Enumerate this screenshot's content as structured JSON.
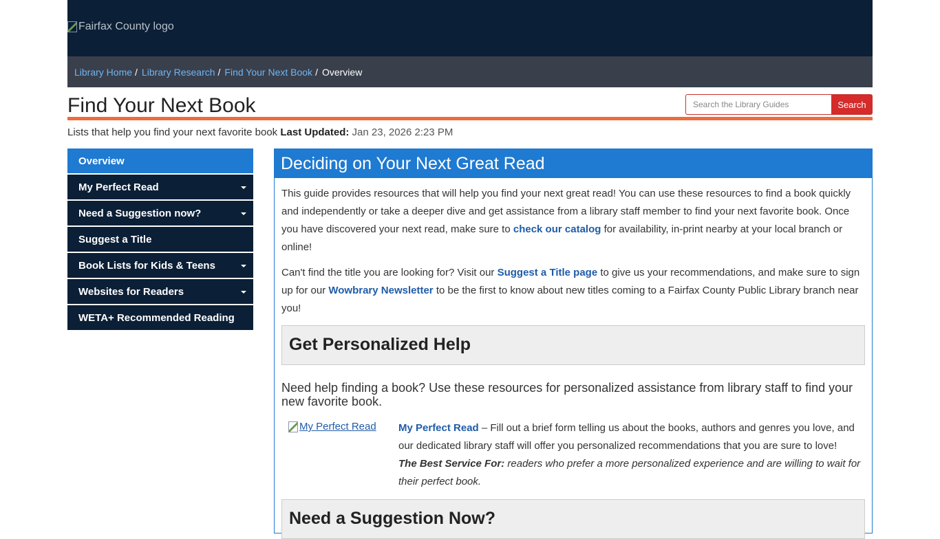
{
  "banner": {
    "logo_alt": "Fairfax County logo"
  },
  "breadcrumb": [
    {
      "label": "Library Home"
    },
    {
      "label": "Library Research"
    },
    {
      "label": "Find Your Next Book"
    },
    {
      "label": "Overview"
    }
  ],
  "breadcrumb_sep": "/",
  "header": {
    "title": "Find Your Next Book",
    "search_placeholder": "Search the Library Guides",
    "search_button": "Search"
  },
  "guide": {
    "description": "Lists that help you find your next favorite book",
    "updated_label": "Last Updated:",
    "updated_value": "Jan 23, 2026 2:23 PM"
  },
  "sidebar": {
    "items": [
      {
        "label": "Overview"
      },
      {
        "label": "My Perfect Read"
      },
      {
        "label": "Need a Suggestion now?"
      },
      {
        "label": "Suggest a Title"
      },
      {
        "label": "Book Lists for Kids & Teens"
      },
      {
        "label": "Websites for Readers"
      },
      {
        "label": "WETA+ Recommended Reading"
      }
    ]
  },
  "main": {
    "heading": "Deciding on Your Next Great Read",
    "p1_before": "This guide provides resources that will help you find your next great read! You can use these resources to find a book quickly and independently or take a deeper dive and get assistance from a library staff member to find your next favorite book. Once you have discovered your next read, make sure to ",
    "p1_link": "check our catalog",
    "p1_after": " for availability, in-print nearby at your local branch or online!",
    "p2_before": "Can't find the title you are looking for? Visit our ",
    "p2_link1": "Suggest a Title page",
    "p2_mid": " to give us your recommendations, and make sure to sign up for our ",
    "p2_link2": "Wowbrary Newsletter",
    "p2_after": " to be the first to know about new titles coming to a Fairfax County Public Library branch near you!",
    "box1_title": "Get Personalized Help",
    "box1_intro": "Need help finding a book? Use these resources for personalized assistance from library staff to find your new favorite book.",
    "pr_img_alt": "My Perfect Read",
    "pr_link": "My Perfect Read",
    "pr_text": " – Fill out a brief form telling us about the books, authors and genres you love, and our dedicated library staff will offer you personalized recommendations that you are sure to love!",
    "pr_best_label": "The Best Service For:",
    "pr_best_text": " readers who prefer a more personalized experience and are willing to wait for their perfect book.",
    "box2_title": "Need a Suggestion Now?"
  }
}
